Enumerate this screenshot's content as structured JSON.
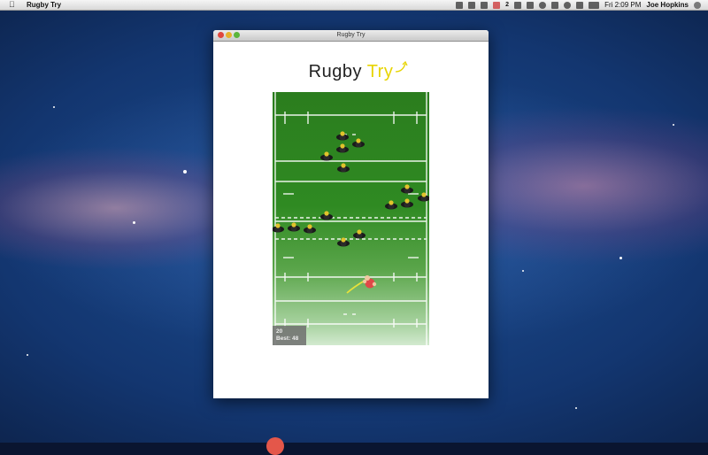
{
  "menubar": {
    "app_name": "Rugby Try",
    "mail_badge": "2",
    "clock": "Fri 2:09 PM",
    "user": "Joe Hopkins"
  },
  "window": {
    "title": "Rugby Try"
  },
  "game": {
    "title_main": "Rugby ",
    "title_accent": "Try",
    "score": "20",
    "best": "Best: 48"
  },
  "colors": {
    "accent": "#e7d400",
    "pitch_dark": "#2b7d1e",
    "defender_jersey": "#1a1a1a",
    "defender_head": "#e2c22c",
    "player_jersey": "#e04848"
  },
  "icons": [
    "apple-icon",
    "battery-icon",
    "bluetooth-icon",
    "wifi-icon",
    "volume-icon",
    "search-icon"
  ]
}
